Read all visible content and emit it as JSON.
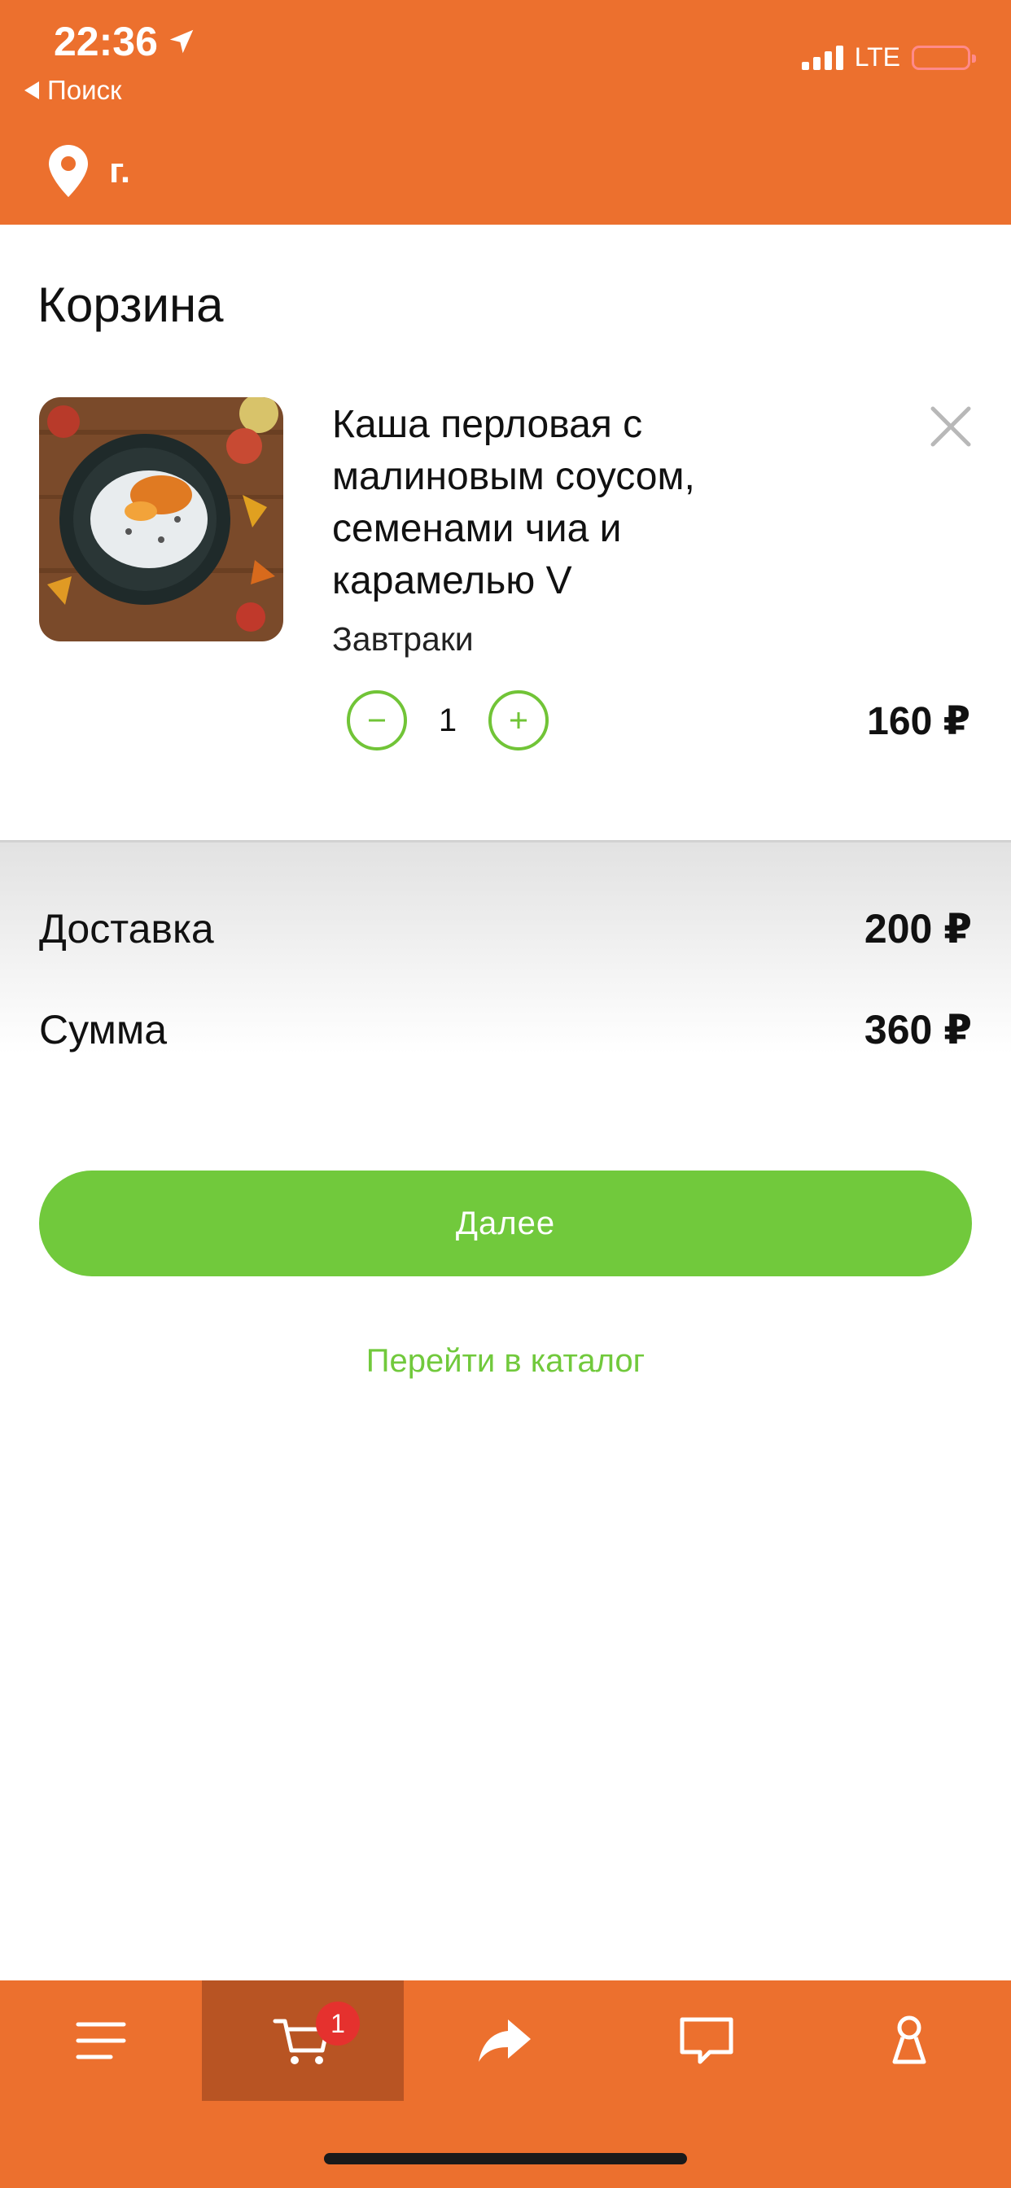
{
  "status_bar": {
    "time": "22:36",
    "back_label": "Поиск",
    "network": "LTE"
  },
  "header": {
    "city": "г."
  },
  "page": {
    "title": "Корзина"
  },
  "cart": {
    "items": [
      {
        "name": "Каша перловая с малиновым соусом, семенами чиа и карамелью V",
        "category": "Завтраки",
        "quantity": "1",
        "price": "160 ₽"
      }
    ]
  },
  "summary": {
    "delivery_label": "Доставка",
    "delivery_value": "200 ₽",
    "sum_label": "Сумма",
    "sum_value": "360 ₽"
  },
  "actions": {
    "next_label": "Далее",
    "catalog_link": "Перейти в каталог"
  },
  "tabbar": {
    "cart_badge": "1",
    "active_tab": "cart"
  },
  "colors": {
    "brand": "#EC702E",
    "brand_dark": "#B85423",
    "accent_green": "#71C93C",
    "badge_red": "#E5312E"
  }
}
